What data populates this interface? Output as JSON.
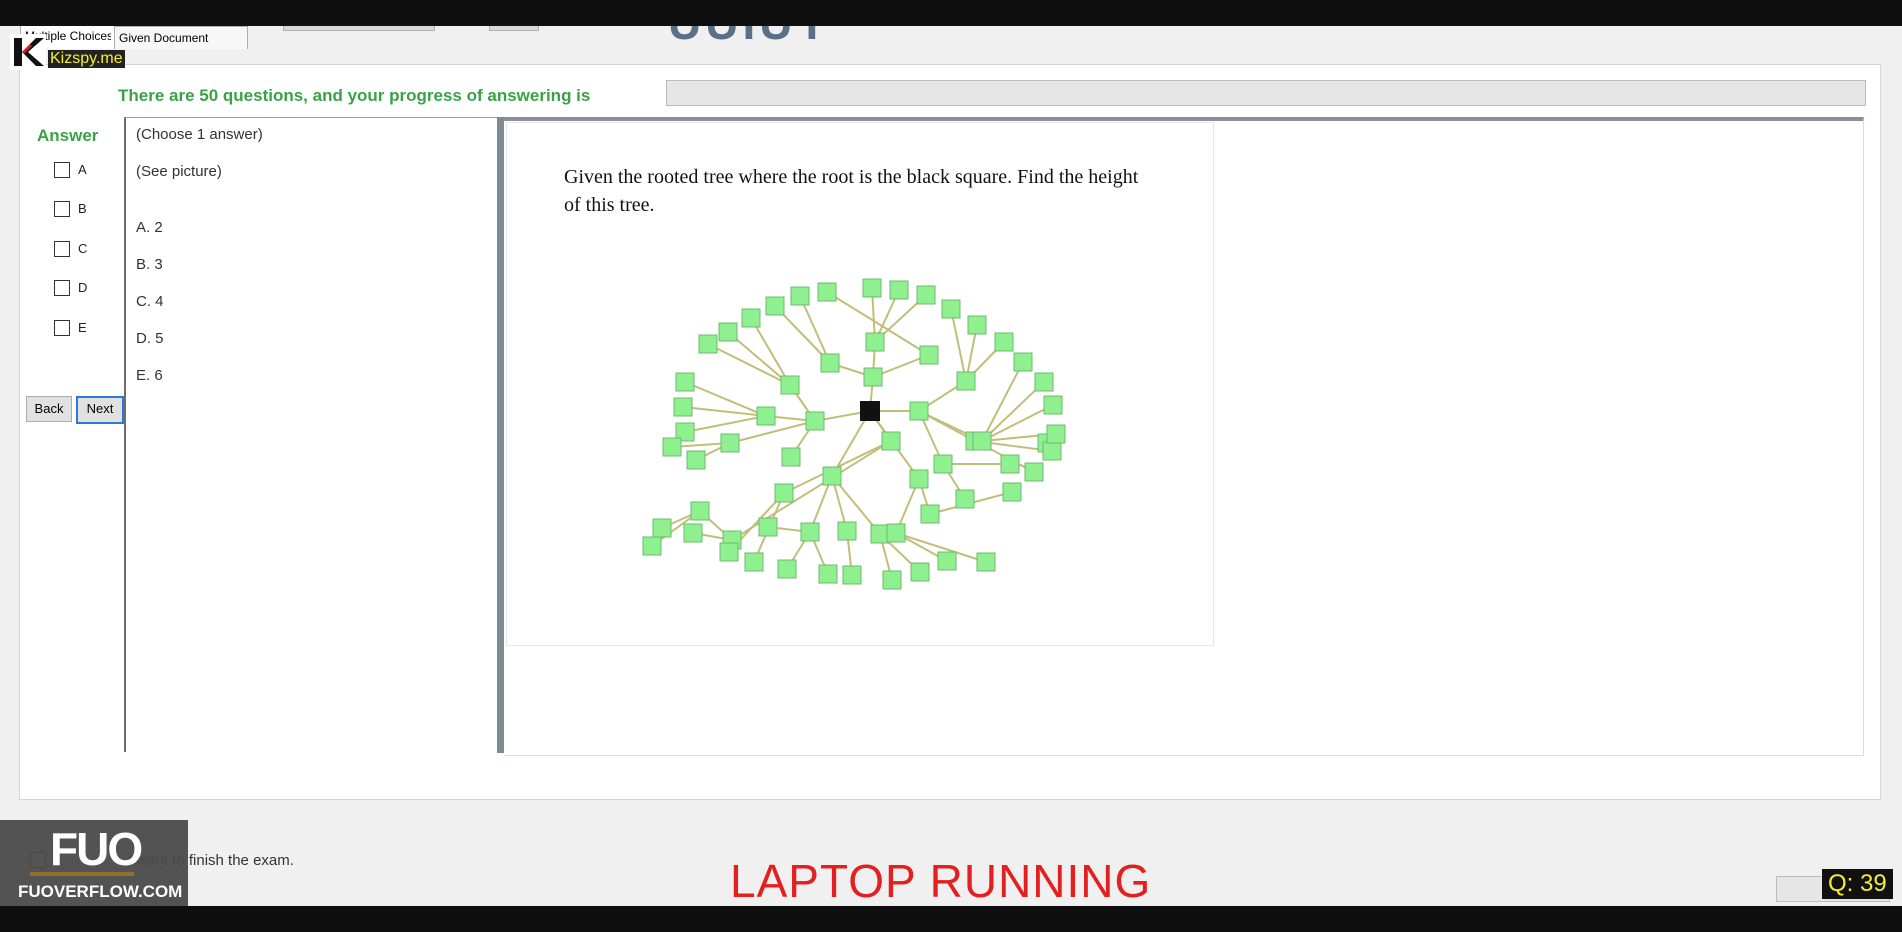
{
  "header": {
    "exam_code_partial": "UUIUY",
    "tabs": [
      {
        "label": "Multiple Choices"
      },
      {
        "label": "Given Document"
      }
    ]
  },
  "watermarks": {
    "kizspy": "Kizspy.me",
    "fuo_logo": "FUO",
    "fuo_site": "FUOVERFLOW.COM",
    "status_banner": "LAPTOP RUNNING",
    "question_counter": "Q: 39"
  },
  "progress": {
    "label": "There are 50 questions, and your progress of answering is",
    "fraction": 0.0
  },
  "answer_panel": {
    "title": "Answer",
    "options": [
      "A",
      "B",
      "C",
      "D",
      "E"
    ],
    "back_label": "Back",
    "next_label": "Next"
  },
  "question": {
    "instruction": "(Choose 1 answer)",
    "see_picture": "(See picture)",
    "choices": [
      "A.  2",
      "B.  3",
      "C.  4",
      "D.  5",
      "E.  6"
    ],
    "image_text": "Given the rooted tree where the root is the black square. Find the height of this tree.",
    "node_color": "#8ff08f",
    "root_color": "#111111",
    "edge_color": "#c2be7a"
  },
  "footer": {
    "finish_text": "I want to finish the exam."
  },
  "colors": {
    "accent_green": "#3aa246",
    "banner_red": "#e31f1f",
    "counter_yellow": "#f6ee2f"
  }
}
